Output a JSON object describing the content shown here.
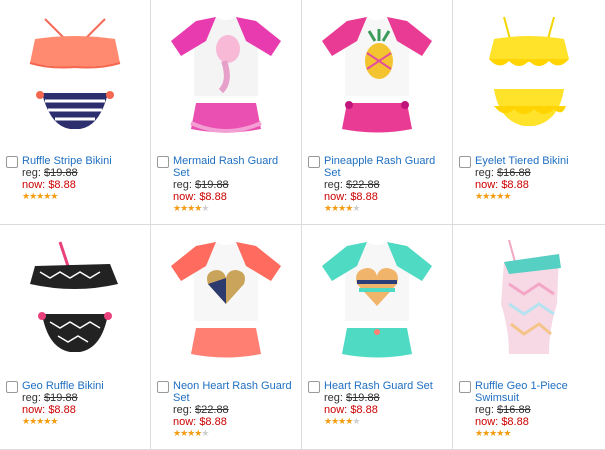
{
  "products": [
    {
      "name": "Ruffle Stripe Bikini",
      "reg_label": "reg:",
      "reg_price": "$19.88",
      "now_label": "now:",
      "now_price": "$8.88",
      "rating": 5,
      "icon": "bikini-ruffle-coral"
    },
    {
      "name": "Mermaid Rash Guard Set",
      "reg_label": "reg:",
      "reg_price": "$19.88",
      "now_label": "now:",
      "now_price": "$8.88",
      "rating": 4,
      "icon": "rash-guard-pink"
    },
    {
      "name": "Pineapple Rash Guard Set",
      "reg_label": "reg:",
      "reg_price": "$22.88",
      "now_label": "now:",
      "now_price": "$8.88",
      "rating": 4,
      "icon": "rash-guard-pineapple"
    },
    {
      "name": "Eyelet Tiered Bikini",
      "reg_label": "reg:",
      "reg_price": "$16.88",
      "now_label": "now:",
      "now_price": "$8.88",
      "rating": 5,
      "icon": "bikini-yellow"
    },
    {
      "name": "Geo Ruffle Bikini",
      "reg_label": "reg:",
      "reg_price": "$19.88",
      "now_label": "now:",
      "now_price": "$8.88",
      "rating": 5,
      "icon": "bikini-geo-black"
    },
    {
      "name": "Neon Heart Rash Guard Set",
      "reg_label": "reg:",
      "reg_price": "$22.88",
      "now_label": "now:",
      "now_price": "$8.88",
      "rating": 3.5,
      "icon": "rash-guard-neon-heart"
    },
    {
      "name": "Heart Rash Guard Set",
      "reg_label": "reg:",
      "reg_price": "$19.88",
      "now_label": "now:",
      "now_price": "$8.88",
      "rating": 4,
      "icon": "rash-guard-mint-heart"
    },
    {
      "name": "Ruffle Geo 1-Piece Swimsuit",
      "reg_label": "reg:",
      "reg_price": "$16.88",
      "now_label": "now:",
      "now_price": "$8.88",
      "rating": 5,
      "icon": "one-piece-geo"
    }
  ],
  "colors": {
    "link": "#1f6fc1",
    "sale": "#cc0000",
    "star": "#f39c12"
  }
}
